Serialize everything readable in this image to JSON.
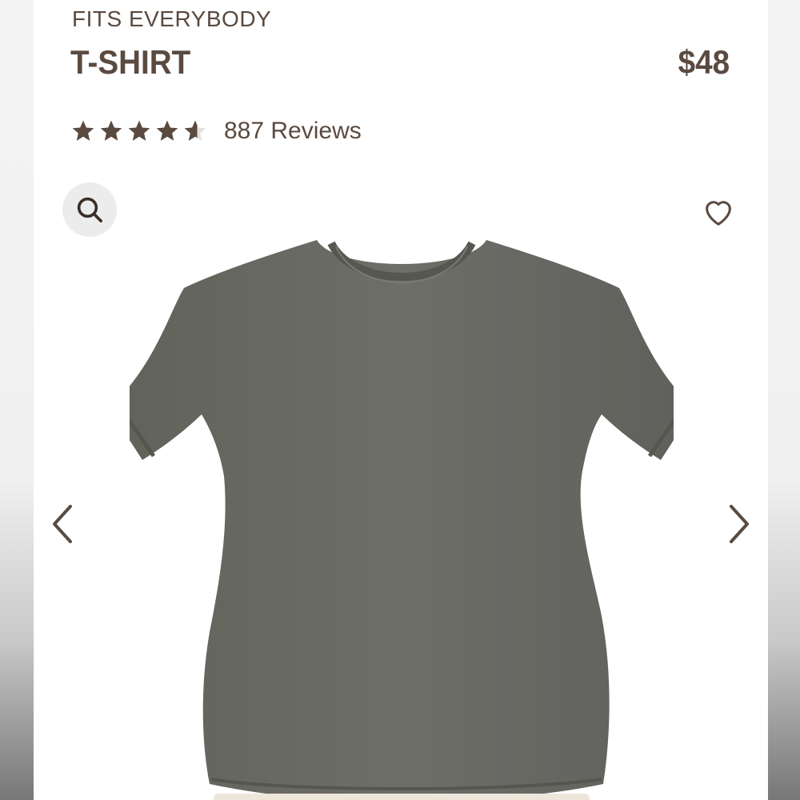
{
  "product": {
    "brand": "FITS EVERYBODY",
    "name": "T-SHIRT",
    "price": "$48",
    "rating": 4.6,
    "reviews_label": "887 Reviews"
  },
  "icons": {
    "zoom": "search-icon",
    "favorite": "heart-icon",
    "prev": "chevron-left-icon",
    "next": "chevron-right-icon"
  },
  "colors": {
    "text": "#5a4a40",
    "shirt": "#6a6b66",
    "zoom_bg": "#ececec"
  }
}
